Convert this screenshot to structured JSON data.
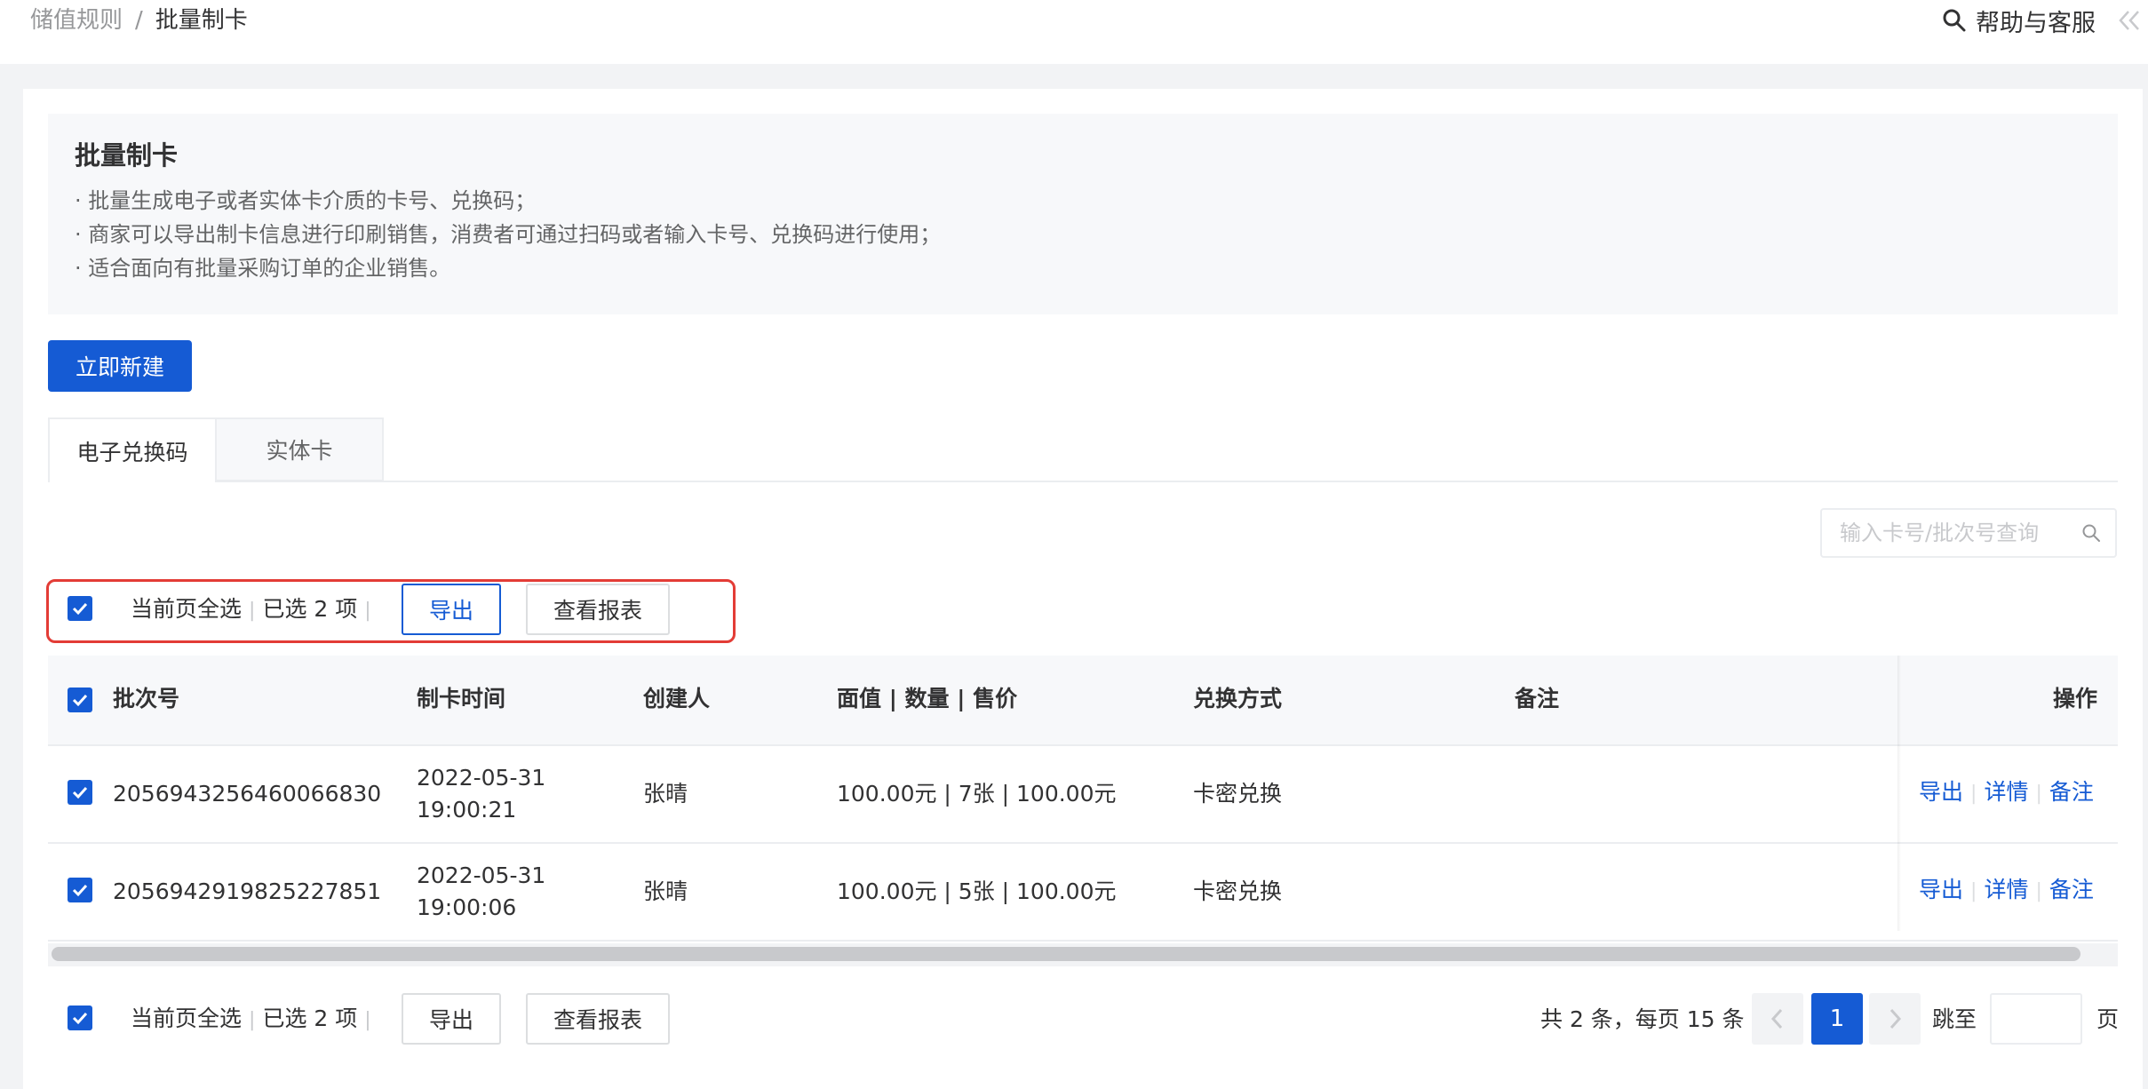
{
  "breadcrumb": {
    "parent": "储值规则",
    "separator": "/",
    "current": "批量制卡"
  },
  "header": {
    "help_label": "帮助与客服"
  },
  "intro": {
    "title": "批量制卡",
    "lines": [
      "· 批量生成电子或者实体卡介质的卡号、兑换码；",
      "· 商家可以导出制卡信息进行印刷销售，消费者可通过扫码或者输入卡号、兑换码进行使用；",
      "· 适合面向有批量采购订单的企业销售。"
    ]
  },
  "create_button": "立即新建",
  "tabs": [
    {
      "label": "电子兑换码",
      "active": true
    },
    {
      "label": "实体卡",
      "active": false
    }
  ],
  "search": {
    "placeholder": "输入卡号/批次号查询"
  },
  "batch_bar": {
    "select_all_label": "当前页全选",
    "selected_text": "已选 2 项",
    "export_label": "导出",
    "report_label": "查看报表"
  },
  "table": {
    "columns": [
      "批次号",
      "制卡时间",
      "创建人",
      "面值 | 数量 | 售价",
      "兑换方式",
      "备注",
      "操作"
    ],
    "rows": [
      {
        "batch_no": "2056943256460066830",
        "date": "2022-05-31",
        "time": "19:00:21",
        "creator": "张晴",
        "value": "100.00元 | 7张 | 100.00元",
        "method": "卡密兑换",
        "note": "",
        "checked": true
      },
      {
        "batch_no": "2056942919825227851",
        "date": "2022-05-31",
        "time": "19:00:06",
        "creator": "张晴",
        "value": "100.00元 | 5张 | 100.00元",
        "method": "卡密兑换",
        "note": "",
        "checked": true
      }
    ],
    "row_actions": {
      "export": "导出",
      "detail": "详情",
      "note": "备注"
    }
  },
  "pagination": {
    "summary": "共 2 条，每页 15 条",
    "current_page": "1",
    "jump_label": "跳至",
    "jump_unit": "页"
  },
  "colors": {
    "primary": "#155bd4",
    "highlight": "#e33c36"
  }
}
